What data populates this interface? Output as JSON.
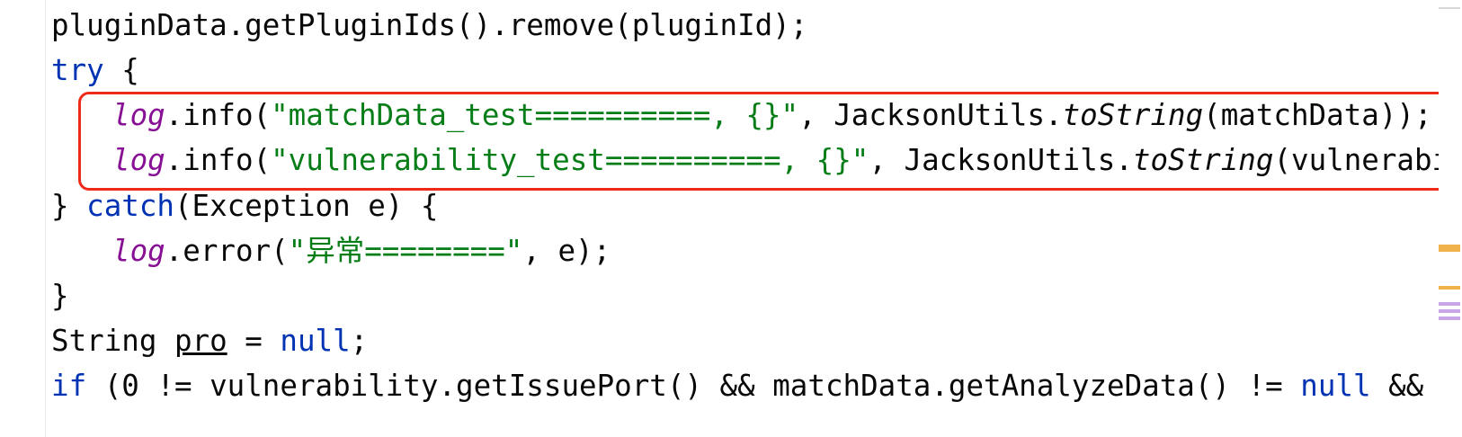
{
  "code": {
    "line1": "pluginData.getPluginIds().remove(pluginId);",
    "line2_kw": "try",
    "line2_rest": " {",
    "line3": {
      "log": "log",
      "call": ".info(",
      "str": "\"matchData_test==========, {}\"",
      "mid": ", JacksonUtils.",
      "method": "toString",
      "tail": "(matchData));"
    },
    "line4": {
      "log": "log",
      "call": ".info(",
      "str": "\"vulnerability_test==========, {}\"",
      "mid": ", JacksonUtils.",
      "method": "toString",
      "tail": "(vulnerability));"
    },
    "line5": {
      "brace": "} ",
      "kw": "catch",
      "rest": "(Exception e) {"
    },
    "line6": {
      "log": "log",
      "call": ".error(",
      "str": "\"异常========\"",
      "tail": ", e);"
    },
    "line7": "}",
    "line8": {
      "type": "String ",
      "var": "pro",
      "eq": " = ",
      "kw": "null",
      "end": ";"
    },
    "line9": {
      "kw1": "if",
      "p1": " (0 != vulnerability.getIssuePort() && matchData.getAnalyzeData() != ",
      "kw2": "null",
      "p2": " && matchData.get"
    }
  },
  "colors": {
    "keyword": "#0033b3",
    "string": "#067d17",
    "static_field": "#871094",
    "highlight_box": "#ee2a1a"
  }
}
